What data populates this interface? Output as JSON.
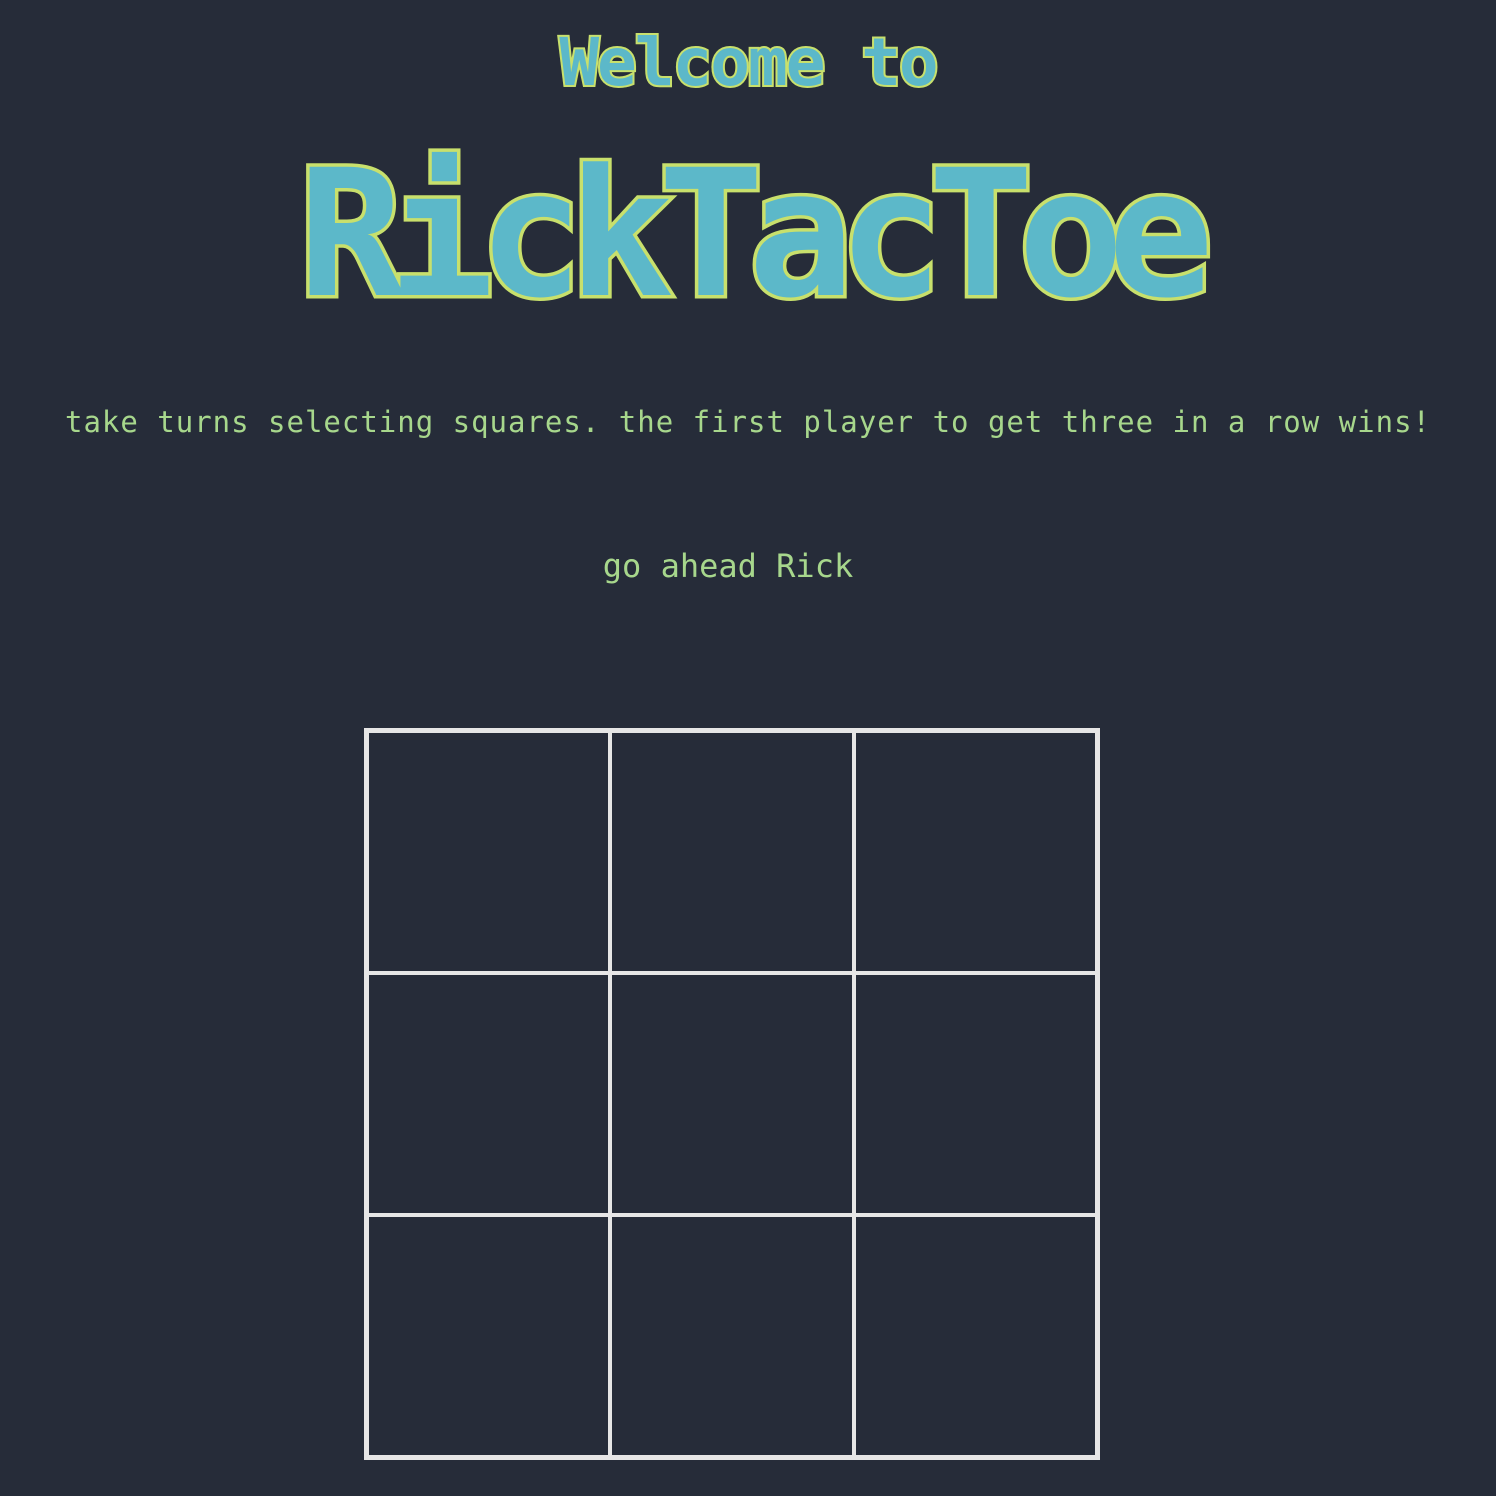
{
  "header": {
    "welcome": "Welcome to",
    "title": "RickTacToe"
  },
  "instructions": "take turns selecting squares. the first player to get three in a row wins!",
  "status": "go ahead Rick",
  "board": {
    "cells": [
      "",
      "",
      "",
      "",
      "",
      "",
      "",
      "",
      ""
    ]
  },
  "colors": {
    "background": "#262c39",
    "title_fill": "#5cb8c9",
    "title_outline": "#c8e06c",
    "text": "#a7d78c",
    "grid_lines": "#e6e6e6"
  }
}
